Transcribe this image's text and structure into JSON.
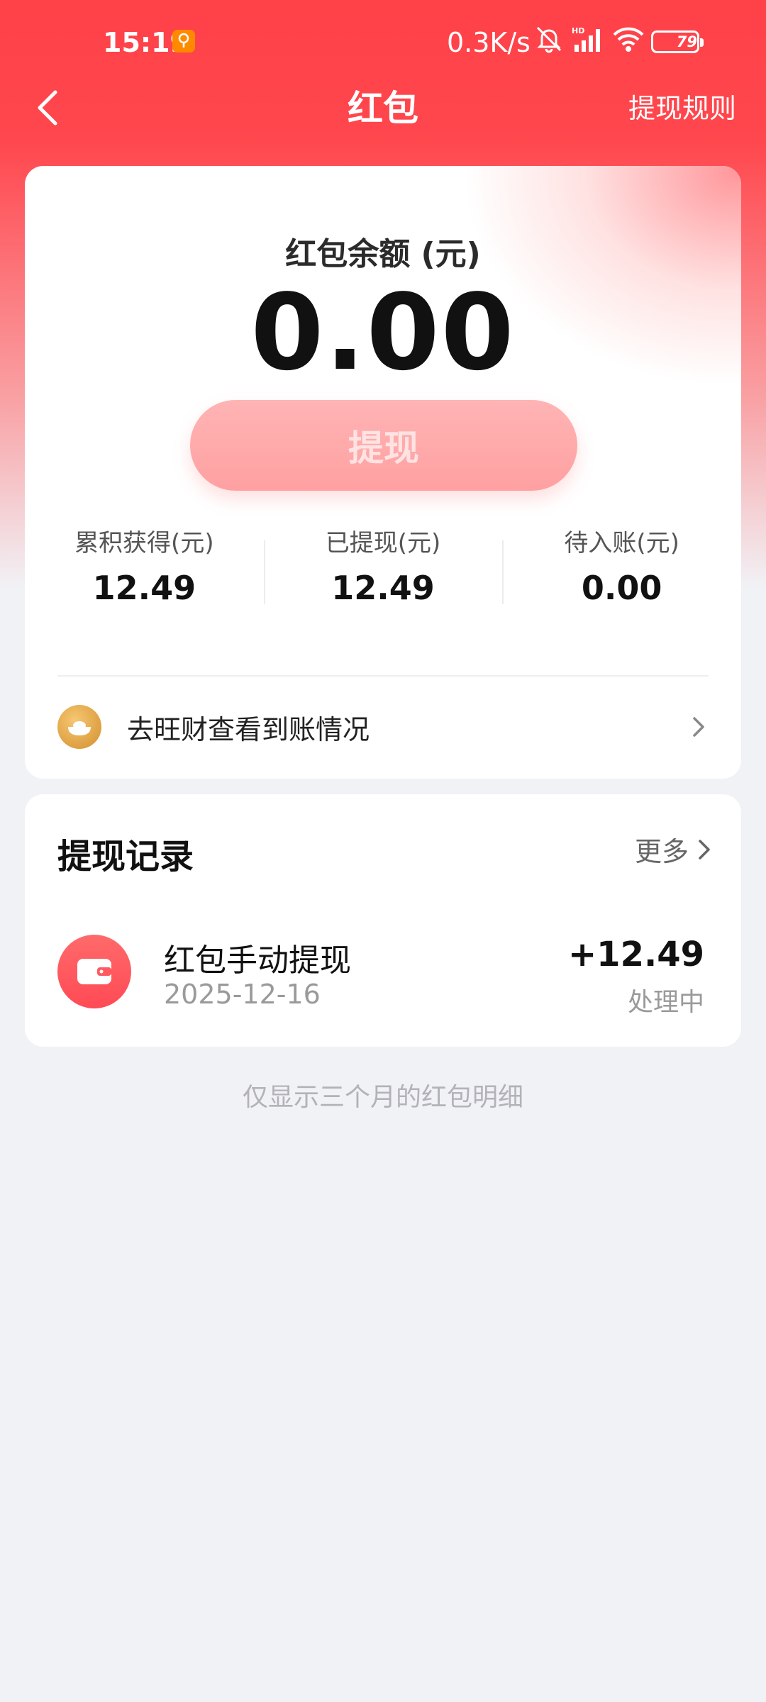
{
  "status_bar": {
    "time": "15:19",
    "network_speed": "0.3K/s",
    "battery": "79"
  },
  "nav": {
    "title": "红包",
    "rules_label": "提现规则"
  },
  "balance": {
    "label": "红包余额 (元)",
    "amount": "0.00",
    "withdraw_label": "提现"
  },
  "stats": [
    {
      "label": "累积获得(元)",
      "value": "12.49"
    },
    {
      "label": "已提现(元)",
      "value": "12.49"
    },
    {
      "label": "待入账(元)",
      "value": "0.00"
    }
  ],
  "account_link": {
    "text": "去旺财查看到账情况"
  },
  "records": {
    "title": "提现记录",
    "more_label": "更多",
    "items": [
      {
        "name": "红包手动提现",
        "date": "2025-12-16",
        "amount": "+12.49",
        "status": "处理中"
      }
    ]
  },
  "footer_note": "仅显示三个月的红包明细",
  "colors": {
    "primary_red": "#ff4148",
    "button_pink": "#ffa8a9",
    "gold": "#e0a040"
  }
}
